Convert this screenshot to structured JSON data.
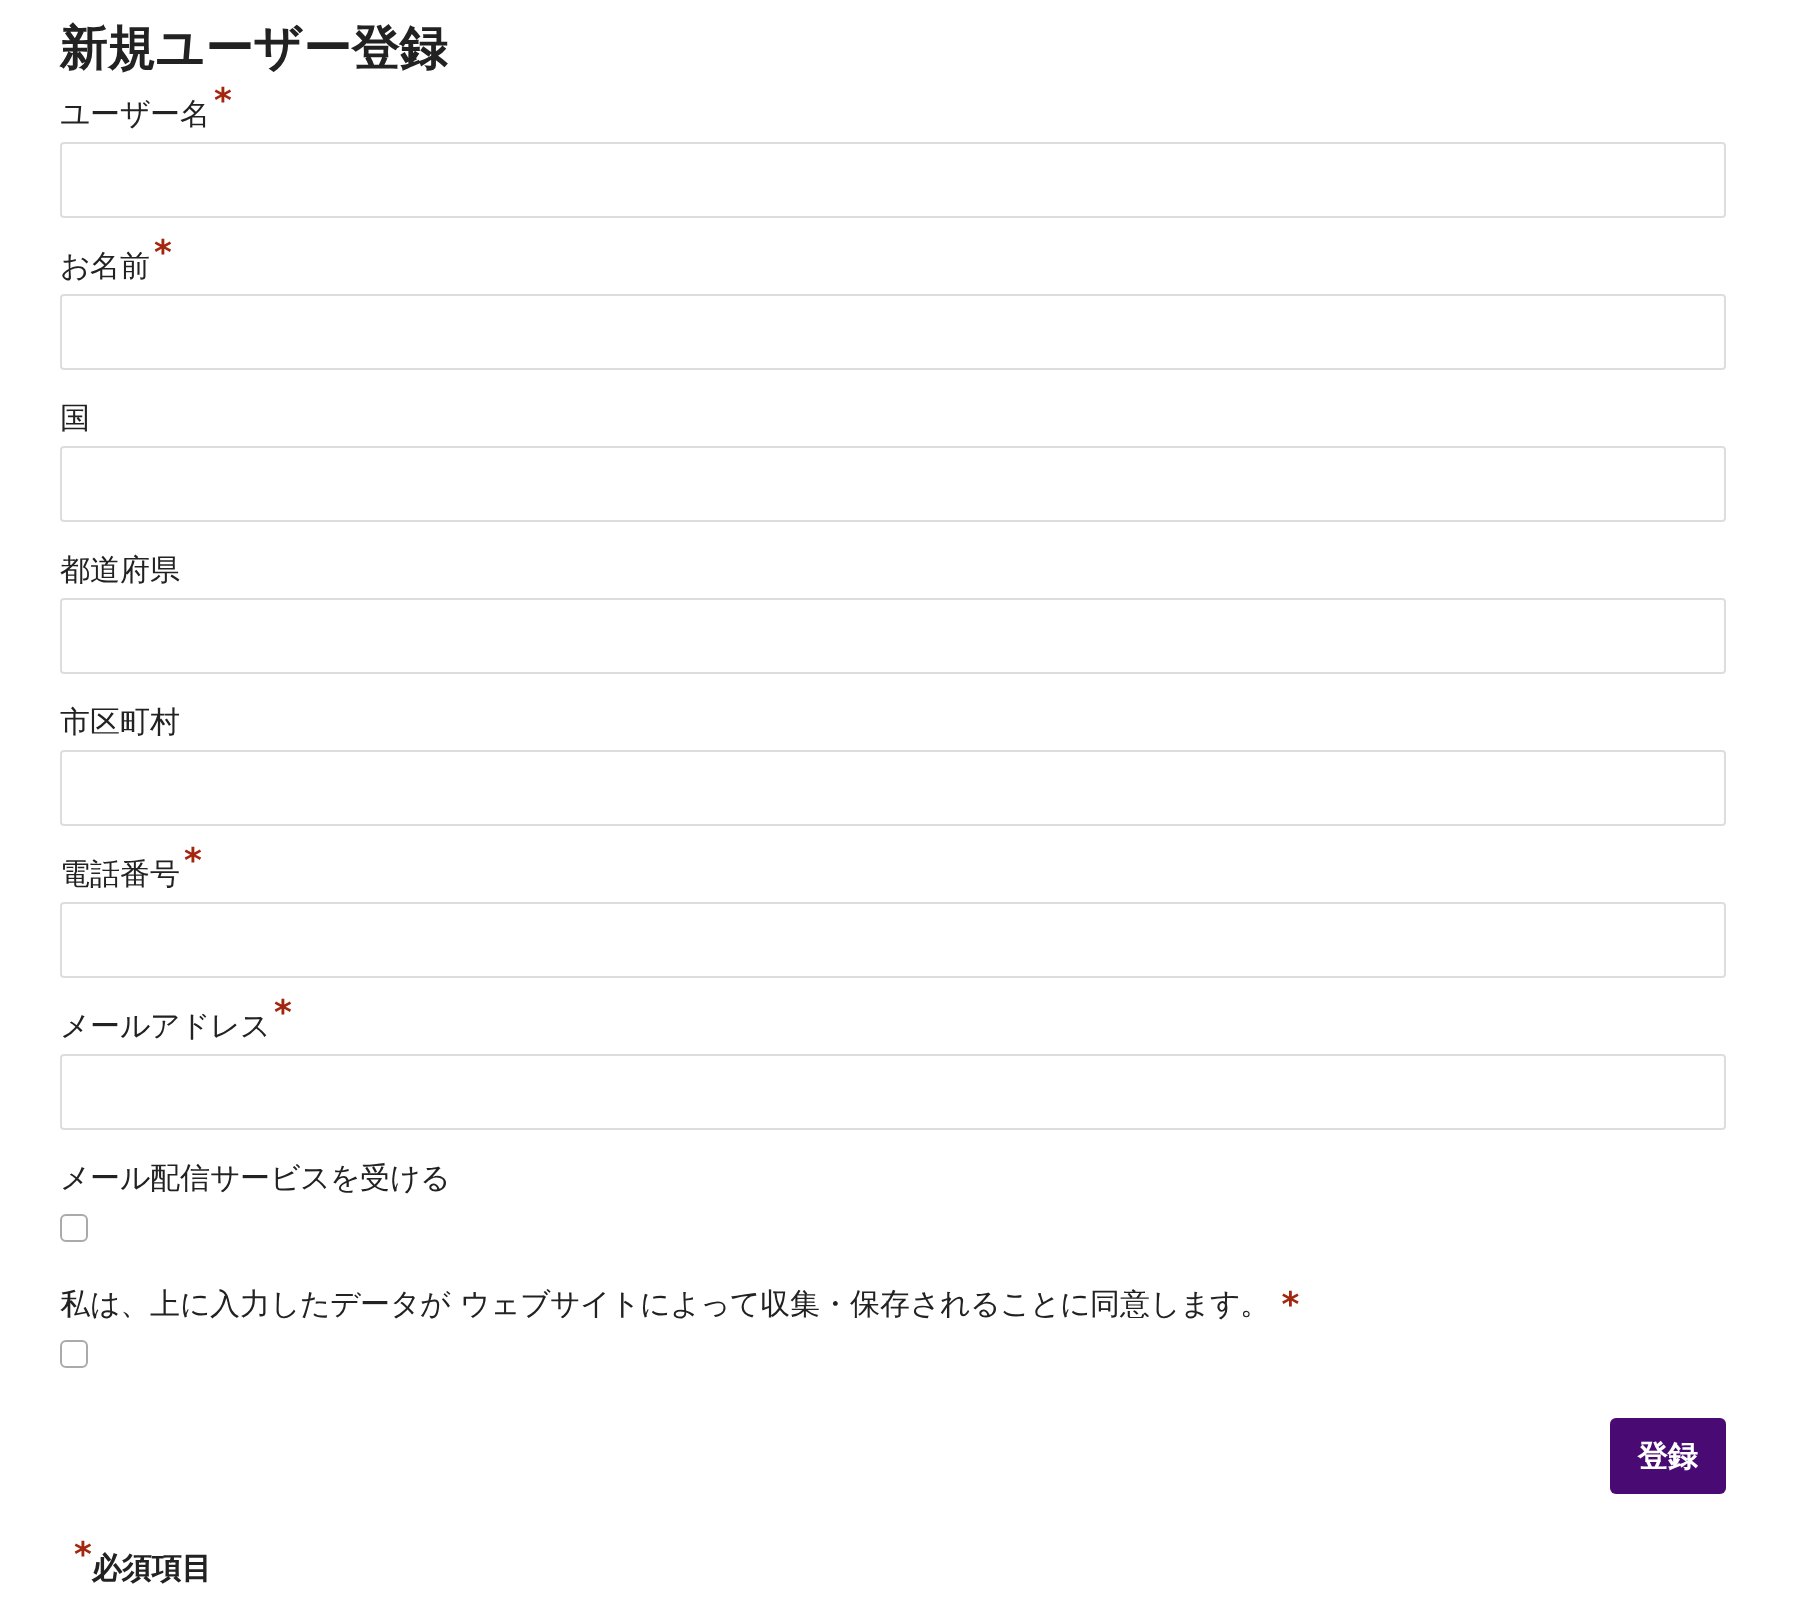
{
  "title": "新規ユーザー登録",
  "fields": [
    {
      "label": "ユーザー名",
      "required_mark": "*"
    },
    {
      "label": "お名前",
      "required_mark": "*"
    },
    {
      "label": "国"
    },
    {
      "label": "都道府県"
    },
    {
      "label": "市区町村"
    },
    {
      "label": "電話番号",
      "required_mark": "*"
    },
    {
      "label": "メールアドレス",
      "required_mark": "*"
    }
  ],
  "checkboxes": [
    {
      "label": "メール配信サービスを受ける",
      "checked": false
    },
    {
      "label": "私は、上に入力したデータが ウェブサイトによって収集・保存されることに同意します。",
      "required_mark": "*",
      "checked": false
    }
  ],
  "submit_button": "登録",
  "footnote": {
    "mark": "*",
    "text": "必須項目"
  }
}
